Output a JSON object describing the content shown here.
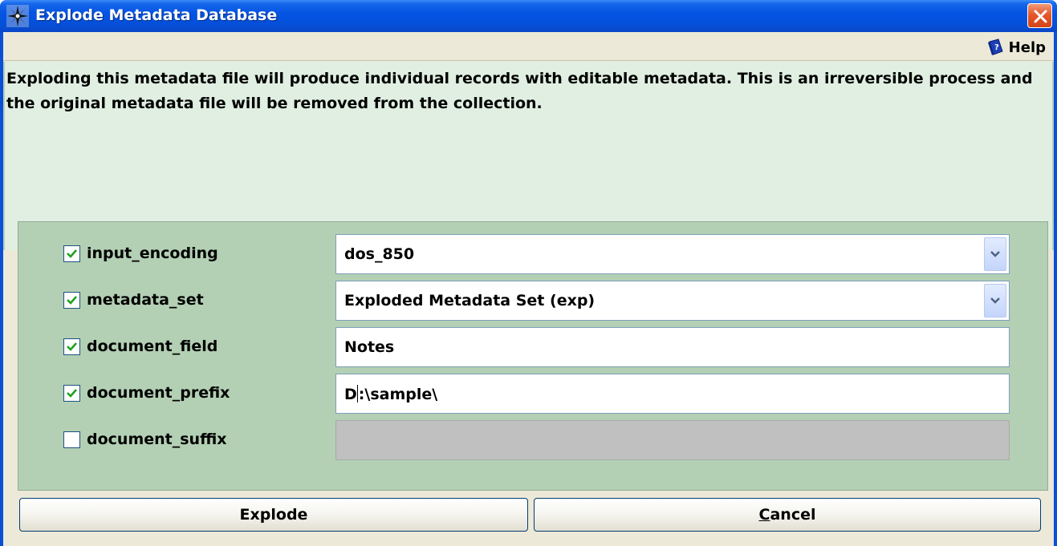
{
  "window": {
    "title": "Explode Metadata Database",
    "app_icon": "compass-star-icon",
    "close_icon": "close-icon"
  },
  "helpbar": {
    "help_label": "Help",
    "help_icon": "help-book-icon"
  },
  "description": "Exploding this metadata file will produce individual records with editable metadata. This is an irreversible process and the original metadata file will be removed from the collection.",
  "options": [
    {
      "label": "input_encoding",
      "checked": true,
      "type": "dropdown",
      "value": "dos_850"
    },
    {
      "label": "metadata_set",
      "checked": true,
      "type": "dropdown",
      "value": "Exploded Metadata Set (exp)"
    },
    {
      "label": "document_field",
      "checked": true,
      "type": "text",
      "value": "Notes"
    },
    {
      "label": "document_prefix",
      "checked": true,
      "type": "text",
      "value_before_caret": "D",
      "value_after_caret": ":\\sample\\"
    },
    {
      "label": "document_suffix",
      "checked": false,
      "type": "text",
      "value": "",
      "disabled": true
    }
  ],
  "buttons": {
    "explode_label": "Explode",
    "cancel_label": "Cancel"
  },
  "colors": {
    "titlebar": "#0554e3",
    "info_bg": "#e0efe1",
    "options_bg": "#b3d0b4",
    "checkmark": "#21a121"
  }
}
